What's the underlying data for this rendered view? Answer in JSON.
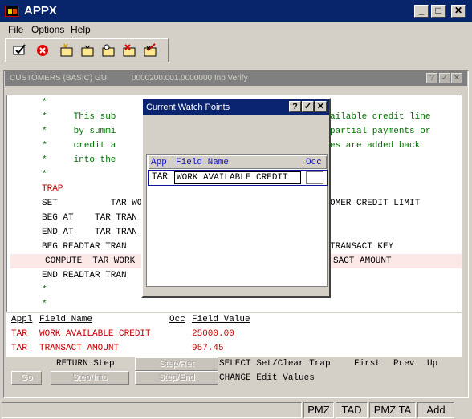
{
  "window": {
    "title": "APPX"
  },
  "menu": [
    "File",
    "Options",
    "Help"
  ],
  "toolbar_icons": [
    "confirm-icon",
    "cancel-icon",
    "new-icon",
    "open-icon",
    "find-icon",
    "delete-icon",
    "edit-icon"
  ],
  "inner_window": {
    "title": "CUSTOMERS (BASIC) GUI",
    "info": "0000200.001.0000000 Inp Verify"
  },
  "code_lines": [
    {
      "left": "*",
      "rest": "",
      "right": "",
      "color": "green",
      "hl": false
    },
    {
      "left": "*",
      "rest": "     This sub",
      "right": "ailable credit line",
      "color": "green",
      "hl": false
    },
    {
      "left": "*",
      "rest": "     by summi",
      "right": "partial payments or",
      "color": "green",
      "hl": false
    },
    {
      "left": "*",
      "rest": "     credit a",
      "right": "es are added back",
      "color": "green",
      "hl": false
    },
    {
      "left": "*",
      "rest": "     into the",
      "right": "",
      "color": "green",
      "hl": false
    },
    {
      "left": "*",
      "rest": "",
      "right": "",
      "color": "green",
      "hl": false
    },
    {
      "left": "TRAP",
      "rest": "",
      "right": "",
      "color": "red",
      "hl": false
    },
    {
      "left": "SET",
      "rest": "     TAR WORK",
      "right": "OMER CREDIT LIMIT",
      "color": "black",
      "hl": false
    },
    {
      "left": "BEG AT",
      "rest": "  TAR TRAN",
      "right": "",
      "color": "black",
      "hl": false
    },
    {
      "left": "END AT",
      "rest": "  TAR TRAN",
      "right": "",
      "color": "black",
      "hl": false
    },
    {
      "left": "BEG READ",
      "rest": "TAR TRAN",
      "right": "TRANSACT KEY",
      "color": "black",
      "hl": false
    },
    {
      "left": "COMPUTE",
      "rest": " TAR WORK",
      "right": "SACT AMOUNT",
      "color": "black",
      "hl": true
    },
    {
      "left": "END READ",
      "rest": "TAR TRAN",
      "right": "",
      "color": "black",
      "hl": false
    },
    {
      "left": "*",
      "rest": "",
      "right": "",
      "color": "green",
      "hl": false
    },
    {
      "left": "*",
      "rest": "",
      "right": "",
      "color": "green",
      "hl": false
    }
  ],
  "watch_header": {
    "appl": "Appl",
    "field": "Field Name",
    "occ": "Occ",
    "value": "Field Value"
  },
  "watch_rows": [
    {
      "appl": "TAR",
      "field": "WORK AVAILABLE CREDIT",
      "occ": "",
      "value": "25000.00"
    },
    {
      "appl": "TAR",
      "field": "TRANSACT AMOUNT",
      "occ": "",
      "value": "957.45"
    }
  ],
  "actions": {
    "return_step": "RETURN Step",
    "step_ret": "Step/Ret",
    "go": "Go",
    "step_into": "Step/Into",
    "step_end": "Step/End",
    "select_line": "SELECT Set/Clear Trap",
    "first": "First",
    "prev": "Prev",
    "up": "Up",
    "change_line": "CHANGE Edit Values"
  },
  "dialog": {
    "title": "Current Watch Points",
    "col_app": "App",
    "col_field": "Field Name",
    "col_occ": "Occ",
    "row": {
      "app": "TAR",
      "field": "WORK AVAILABLE CREDIT",
      "occ": ""
    }
  },
  "status": [
    "PMZ",
    "TAD",
    "PMZ TA",
    "Add"
  ]
}
